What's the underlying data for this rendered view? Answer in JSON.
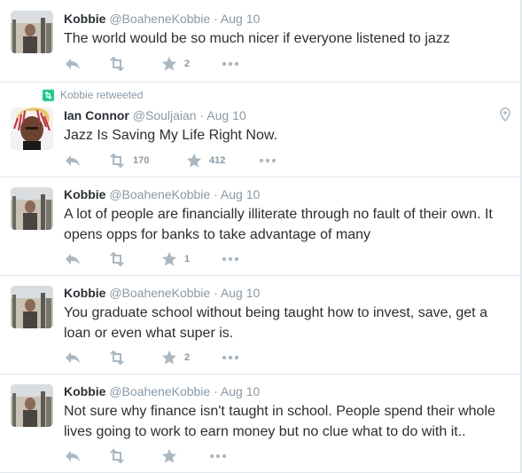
{
  "tweets": [
    {
      "fullname": "Kobbie",
      "handle": "@BoaheneKobbie",
      "time": "Aug 10",
      "text": "The world would be so much nicer if everyone listened to jazz",
      "retweets": "",
      "likes": "2"
    },
    {
      "context": "Kobbie retweeted",
      "fullname": "Ian Connor",
      "handle": "@Souljaian",
      "time": "Aug 10",
      "text": "Jazz Is Saving My Life Right Now.",
      "retweets": "170",
      "likes": "412"
    },
    {
      "fullname": "Kobbie",
      "handle": "@BoaheneKobbie",
      "time": "Aug 10",
      "text": "A lot of people are financially illiterate through no fault of their own. It opens opps for banks to take advantage of many",
      "retweets": "",
      "likes": "1"
    },
    {
      "fullname": "Kobbie",
      "handle": "@BoaheneKobbie",
      "time": "Aug 10",
      "text": "You graduate school without being taught how to invest, save, get a loan or even what super is.",
      "retweets": "",
      "likes": "2"
    },
    {
      "fullname": "Kobbie",
      "handle": "@BoaheneKobbie",
      "time": "Aug 10",
      "text": "Not sure why finance isn't taught in school. People spend their whole lives going to work to earn money but no clue what to do with it..",
      "retweets": "",
      "likes": ""
    }
  ],
  "separator": "·",
  "colors": {
    "text": "#292f33",
    "muted": "#8899a6",
    "icon": "#aab8c2",
    "retweet_green": "#19cf86",
    "border": "#e1e8ed"
  },
  "icons": [
    "reply-icon",
    "retweet-icon",
    "like-star-icon",
    "more-icon",
    "location-pin-icon"
  ]
}
